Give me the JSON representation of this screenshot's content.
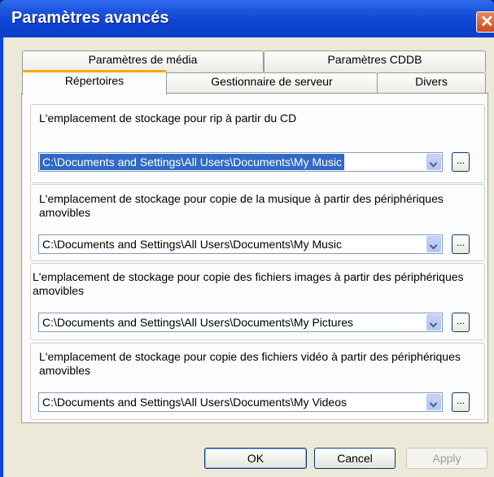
{
  "window": {
    "title": "Paramètres avancés",
    "close_glyph": "✕"
  },
  "tabs": {
    "row1": [
      "Paramètres de média",
      "Paramètres CDDB"
    ],
    "row2": [
      "Répertoires",
      "Gestionnaire de serveur",
      "Divers"
    ],
    "active": "Répertoires"
  },
  "groups": [
    {
      "label": "L'emplacement de stockage pour rip à partir du CD",
      "value": "C:\\Documents and Settings\\All Users\\Documents\\My Music",
      "selected": true
    },
    {
      "label": "L'emplacement de stockage pour copie de la musique à partir des périphériques amovibles",
      "value": "C:\\Documents and Settings\\All Users\\Documents\\My Music",
      "selected": false
    },
    {
      "label": "L'emplacement de stockage pour copie des fichiers images à partir des périphériques amovibles",
      "value": "C:\\Documents and Settings\\All Users\\Documents\\My Pictures",
      "selected": false
    },
    {
      "label": "L'emplacement de stockage pour copie des fichiers vidéo à partir des périphériques amovibles",
      "value": "C:\\Documents and Settings\\All Users\\Documents\\My Videos",
      "selected": false
    }
  ],
  "browse_label": "...",
  "buttons": {
    "ok": "OK",
    "cancel": "Cancel",
    "apply": "Apply"
  },
  "colors": {
    "titlebar": "#0f45d3",
    "selection": "#316ac5",
    "active_tab_accent": "#f7a80a"
  }
}
